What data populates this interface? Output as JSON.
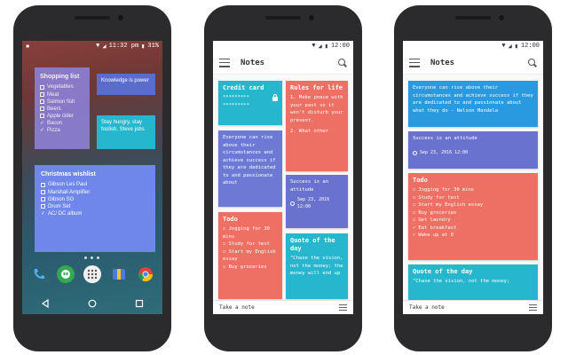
{
  "phone1": {
    "status_time": "11:32 pm",
    "status_battery": "31%",
    "shopping": {
      "title": "Shopping list",
      "items": [
        {
          "text": "Vegetables",
          "checked": false
        },
        {
          "text": "Meat",
          "checked": false
        },
        {
          "text": "Salmon fish",
          "checked": false
        },
        {
          "text": "Beers",
          "checked": false
        },
        {
          "text": "Apple cider",
          "checked": false
        },
        {
          "text": "Bacon",
          "checked": true
        },
        {
          "text": "Pizza",
          "checked": true
        }
      ]
    },
    "knowledge": "Knowledge is power",
    "hungry": "Stay hungry, stay foolish. Steve jobs",
    "xmas": {
      "title": "Christmas wishlist",
      "items": [
        {
          "text": "Gibson Les Paul",
          "checked": false
        },
        {
          "text": "Marshall Amplifier",
          "checked": false
        },
        {
          "text": "Gibson SG",
          "checked": false
        },
        {
          "text": "Drum Set",
          "checked": false
        },
        {
          "text": "AC/ DC album",
          "checked": true
        }
      ]
    }
  },
  "notes_app": {
    "status_time": "12:00",
    "title": "Notes",
    "take_note": "Take a note",
    "check": "✓",
    "box": "☐"
  },
  "phone2": {
    "credit": {
      "title": "Credit card",
      "line1": "*********",
      "line2": "*********"
    },
    "rules": {
      "title": "Rules for life",
      "body1": "1. Make peace with your past so it won't disturb your present.",
      "body2": "2. What other"
    },
    "quote1": "Everyone can rise above their circumstances and achieve success if they are dedicated to and passionate about",
    "success": {
      "text": "Success is an attitude",
      "date": "Sep 23, 2016 12:00"
    },
    "todo": {
      "title": "Todo",
      "items": [
        "Jogging for 30 mins",
        "Study for test",
        "Start my English essay",
        "Buy groceries"
      ]
    },
    "qod": {
      "title": "Quote of the day",
      "body": "\"Chase the vision, not the money; the money will end up"
    }
  },
  "phone3": {
    "quote": "Everyone can rise above their circumstances and achieve success if they are dedicated to and passionate about what they do - Nelson Mandela",
    "success": {
      "text": "Success is an attitude",
      "date": "Sep 23, 2016 12:00"
    },
    "todo": {
      "title": "Todo",
      "items": [
        {
          "text": "Jogging for 30 mins",
          "checked": false
        },
        {
          "text": "Study for test",
          "checked": false
        },
        {
          "text": "Start my English essay",
          "checked": false
        },
        {
          "text": "Buy groceries",
          "checked": false
        },
        {
          "text": "Get laundry",
          "checked": false
        },
        {
          "text": "Eat breakfast",
          "checked": true
        },
        {
          "text": "Wake up at 8",
          "checked": true
        }
      ]
    },
    "qod": {
      "title": "Quote of the day",
      "body": "\"Chase the vision, not the money;"
    }
  },
  "colors": {
    "cyan": "#26b7cf",
    "purple_blue": "#6c7ad6",
    "salmon": "#ee6f63",
    "blue": "#2a9ae0",
    "indigo": "#6a72cf"
  }
}
